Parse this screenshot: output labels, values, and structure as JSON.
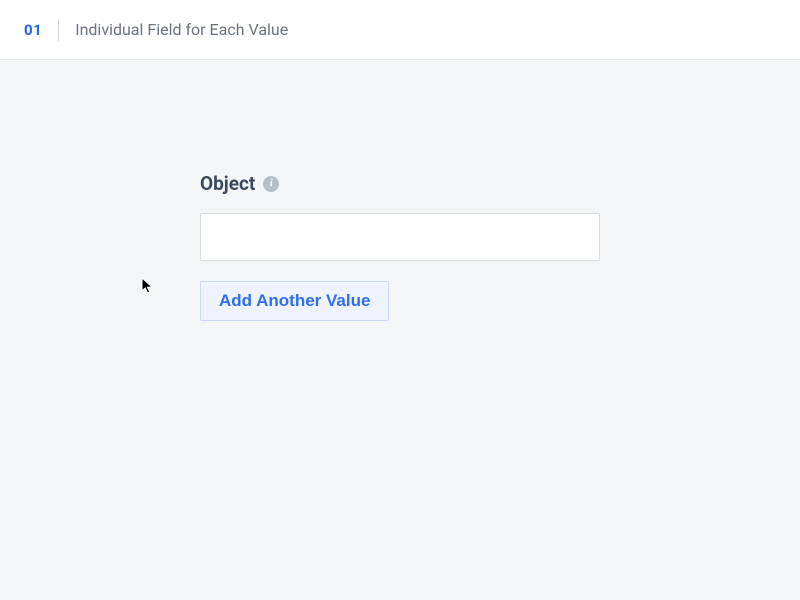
{
  "header": {
    "step_number": "01",
    "step_title": "Individual Field for Each Value"
  },
  "form": {
    "label": "Object",
    "info_glyph": "i",
    "input_value": "",
    "add_button_label": "Add Another Value"
  }
}
